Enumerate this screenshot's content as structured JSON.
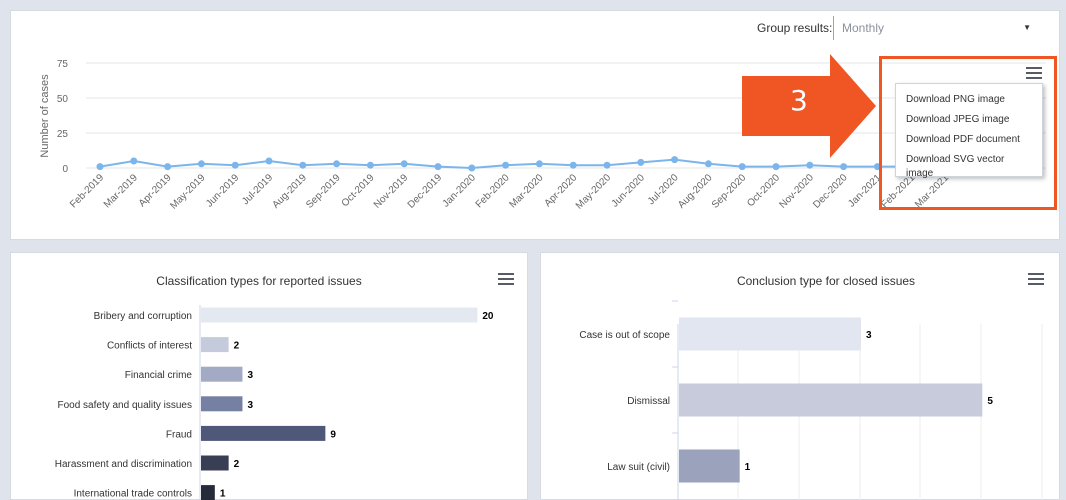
{
  "group_results": {
    "label": "Group results:",
    "value": "Monthly"
  },
  "download_menu": {
    "items": [
      "Download PNG image",
      "Download JPEG image",
      "Download PDF document",
      "Download SVG vector image"
    ]
  },
  "callout": {
    "number": "3",
    "color": "#ef5623"
  },
  "icons": {
    "menu": "hamburger-menu-icon",
    "caret": "caret-down-icon"
  },
  "colors": {
    "line": "#7cb5ec",
    "accent": "#ef5623"
  },
  "chart_data": [
    {
      "type": "line",
      "title": "",
      "ylabel": "Number of cases",
      "xlabel": "",
      "ylim": [
        0,
        75
      ],
      "yticks": [
        0,
        25,
        50,
        75
      ],
      "grid": true,
      "x": [
        "Feb-2019",
        "Mar-2019",
        "Apr-2019",
        "May-2019",
        "Jun-2019",
        "Jul-2019",
        "Aug-2019",
        "Sep-2019",
        "Oct-2019",
        "Nov-2019",
        "Dec-2019",
        "Jan-2020",
        "Feb-2020",
        "Mar-2020",
        "Apr-2020",
        "May-2020",
        "Jun-2020",
        "Jul-2020",
        "Aug-2020",
        "Sep-2020",
        "Oct-2020",
        "Nov-2020",
        "Dec-2020",
        "Jan-2021",
        "Feb-2021",
        "Mar-2021"
      ],
      "series": [
        {
          "values": [
            1,
            5,
            1,
            3,
            2,
            5,
            2,
            3,
            2,
            3,
            1,
            0,
            2,
            3,
            2,
            2,
            4,
            6,
            3,
            1,
            1,
            2,
            1,
            1,
            1,
            1
          ]
        }
      ]
    },
    {
      "type": "bar",
      "orientation": "horizontal",
      "title": "Classification types for reported issues",
      "categories": [
        "Bribery and corruption",
        "Conflicts of interest",
        "Financial crime",
        "Food safety and quality issues",
        "Fraud",
        "Harassment and discrimination",
        "International trade controls"
      ],
      "values": [
        20,
        2,
        3,
        3,
        9,
        2,
        1
      ],
      "bar_colors": [
        "#e4e8f0",
        "#c6cbdb",
        "#a3aac3",
        "#7680a3",
        "#4f5878",
        "#383f55",
        "#262b3a"
      ],
      "xlim": [
        0,
        22
      ]
    },
    {
      "type": "bar",
      "orientation": "horizontal",
      "title": "Conclusion type for closed issues",
      "categories": [
        "Case is out of scope",
        "Dismissal",
        "Law suit (civil)"
      ],
      "values": [
        3,
        5,
        1
      ],
      "bar_colors": [
        "#e2e6f0",
        "#c7cbdc",
        "#9aa2bc"
      ],
      "xlim": [
        0,
        6
      ]
    }
  ]
}
